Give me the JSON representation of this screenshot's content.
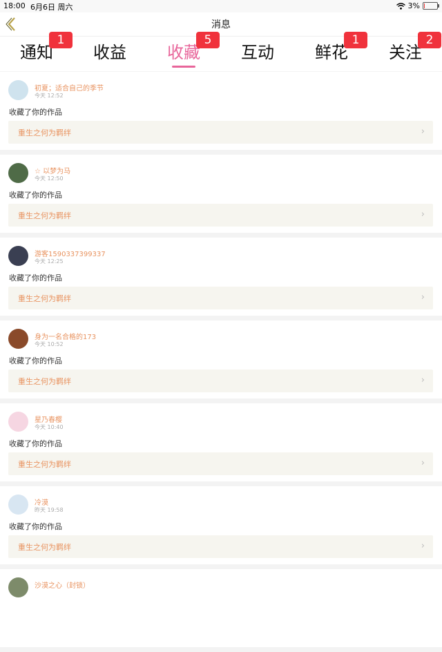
{
  "status": {
    "time": "18:00",
    "date": "6月6日 周六",
    "battery": "3%",
    "battery_level": 0.03
  },
  "nav": {
    "title": "消息"
  },
  "tabs": [
    {
      "label": "通知",
      "badge": "1",
      "active": false
    },
    {
      "label": "收益",
      "badge": "",
      "active": false
    },
    {
      "label": "收藏",
      "badge": "5",
      "active": true
    },
    {
      "label": "互动",
      "badge": "",
      "active": false
    },
    {
      "label": "鲜花",
      "badge": "1",
      "active": false
    },
    {
      "label": "关注",
      "badge": "2",
      "active": false
    }
  ],
  "items": [
    {
      "name": "初夏；适合自己的季节",
      "time": "今天 12:52",
      "action": "收藏了你的作品",
      "work": "重生之何为羁绊",
      "avatar_color": "#cfe3ee"
    },
    {
      "name": "☆ 以梦为马",
      "time": "今天 12:50",
      "action": "收藏了你的作品",
      "work": "重生之何为羁绊",
      "avatar_color": "#4f6b47"
    },
    {
      "name": "游客1590337399337",
      "time": "今天 12:25",
      "action": "收藏了你的作品",
      "work": "重生之何为羁绊",
      "avatar_color": "#3a3f52"
    },
    {
      "name": "身为一名合格的173",
      "time": "今天 10:52",
      "action": "收藏了你的作品",
      "work": "重生之何为羁绊",
      "avatar_color": "#8a4a2a"
    },
    {
      "name": "星乃春樱",
      "time": "今天 10:40",
      "action": "收藏了你的作品",
      "work": "重生之何为羁绊",
      "avatar_color": "#f6d6e2"
    },
    {
      "name": "冷漠",
      "time": "昨天 19:58",
      "action": "收藏了你的作品",
      "work": "重生之何为羁绊",
      "avatar_color": "#d8e6f2"
    },
    {
      "name": "沙漠之心（封锁）",
      "time": "",
      "action": "",
      "work": "",
      "avatar_color": "#7d8b6a"
    }
  ]
}
